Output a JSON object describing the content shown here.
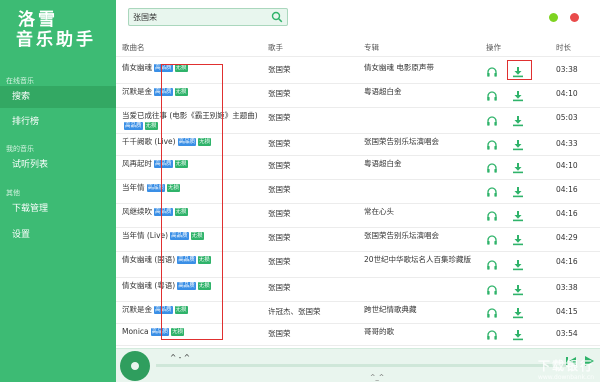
{
  "app": {
    "brand_line1": "洛雪",
    "brand_line2": "音乐助手"
  },
  "sidebar": {
    "online_title": "在线音乐",
    "my_title": "我的音乐",
    "other_title": "其他",
    "items": [
      {
        "label": "搜索",
        "active": true
      },
      {
        "label": "排行榜",
        "active": false
      },
      {
        "label": "试听列表",
        "active": false
      },
      {
        "label": "下载管理",
        "active": false
      },
      {
        "label": "设置",
        "active": false
      }
    ]
  },
  "search": {
    "value": "张国荣",
    "icon": "search-icon"
  },
  "window_controls": {
    "minimize_color": "#7ed321",
    "close_color": "#e94b4b"
  },
  "table": {
    "headers": {
      "title": "歌曲名",
      "singer": "歌手",
      "album": "专辑",
      "action": "操作",
      "duration": "时长"
    },
    "tag_hq": "高品质",
    "tag_ls": "无损",
    "rows": [
      {
        "title": "倩女幽魂",
        "hq": true,
        "ls": true,
        "singer": "张国荣",
        "album": "倩女幽魂 电影原声带",
        "duration": "03:38"
      },
      {
        "title": "沉默是金",
        "hq": true,
        "ls": true,
        "singer": "张国荣",
        "album": "粤语超白金",
        "duration": "04:10"
      },
      {
        "title": "当爱已成往事 (电影《霸王别姬》主题曲)",
        "hq": true,
        "ls": true,
        "singer": "张国荣",
        "album": "",
        "duration": "05:03"
      },
      {
        "title": "千千阙歌 (Live)",
        "hq": true,
        "ls": true,
        "singer": "张国荣",
        "album": "张国荣告别乐坛演唱会",
        "duration": "04:33"
      },
      {
        "title": "风再起时",
        "hq": true,
        "ls": true,
        "singer": "张国荣",
        "album": "粤语超白金",
        "duration": "04:10"
      },
      {
        "title": "当年情",
        "hq": true,
        "ls": true,
        "singer": "张国荣",
        "album": "",
        "duration": "04:16"
      },
      {
        "title": "风继续吹",
        "hq": true,
        "ls": true,
        "singer": "张国荣",
        "album": "常在心头",
        "duration": "04:16"
      },
      {
        "title": "当年情 (Live)",
        "hq": true,
        "ls": true,
        "singer": "张国荣",
        "album": "张国荣告别乐坛演唱会",
        "duration": "04:29"
      },
      {
        "title": "倩女幽魂 (国语)",
        "hq": true,
        "ls": true,
        "singer": "张国荣",
        "album": "20世纪中华歌坛名人百集珍藏版",
        "duration": "04:16"
      },
      {
        "title": "倩女幽魂 (粤语)",
        "hq": true,
        "ls": true,
        "singer": "张国荣",
        "album": "",
        "duration": "03:38"
      },
      {
        "title": "沉默是金",
        "hq": true,
        "ls": true,
        "singer": "许冠杰、张国荣",
        "album": "跨世纪情歌典藏",
        "duration": "04:15"
      },
      {
        "title": "Monica",
        "hq": true,
        "ls": true,
        "singer": "张国荣",
        "album": "哥哥的歌",
        "duration": "03:54"
      }
    ]
  },
  "player": {
    "title": "^ - ^",
    "time_text": "^_^",
    "progress": 0
  },
  "watermark": {
    "text": "下载银行",
    "url": "www.downbank.cn"
  }
}
